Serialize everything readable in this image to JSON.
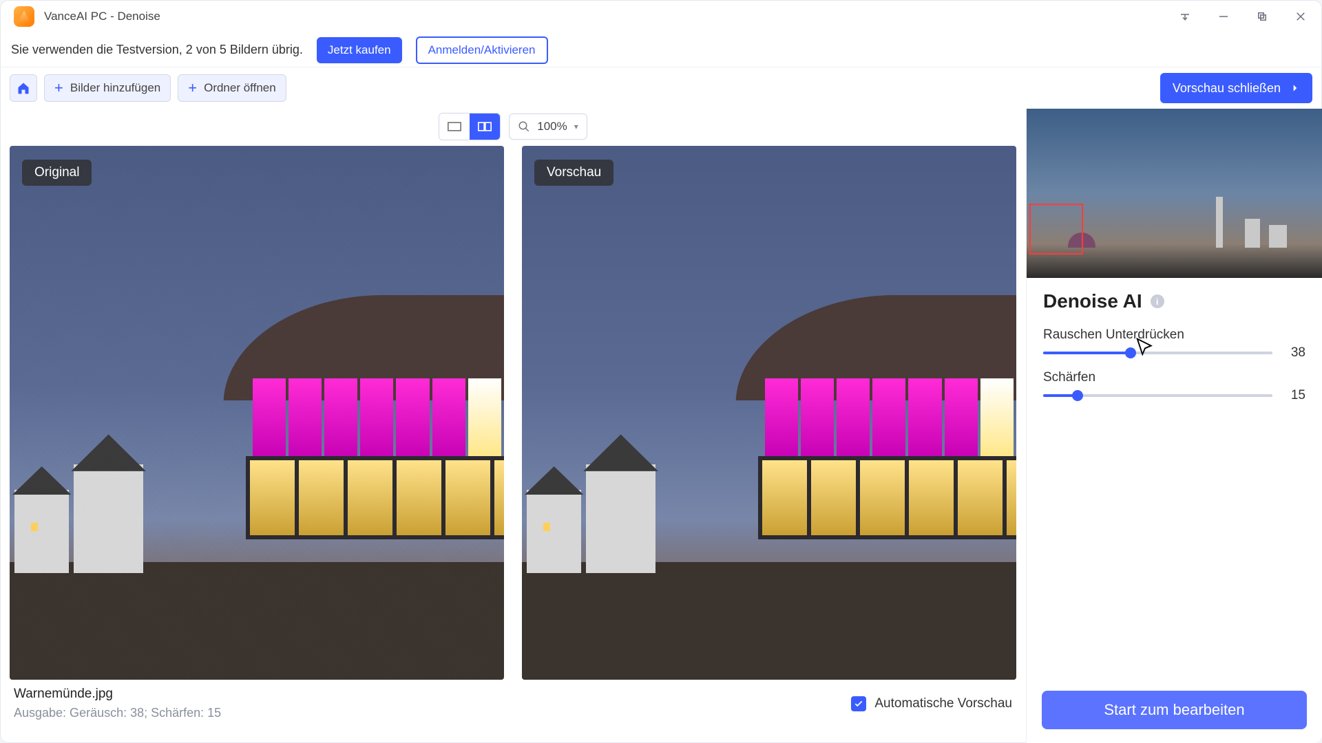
{
  "titlebar": {
    "title": "VanceAI PC - Denoise"
  },
  "trial": {
    "message": "Sie verwenden die Testversion, 2 von 5 Bildern übrig.",
    "buy": "Jetzt kaufen",
    "login": "Anmelden/Aktivieren"
  },
  "toolbar": {
    "add_images": "Bilder hinzufügen",
    "open_folder": "Ordner öffnen",
    "close_preview": "Vorschau schließen"
  },
  "view": {
    "zoom": "100%"
  },
  "compare": {
    "original_badge": "Original",
    "preview_badge": "Vorschau"
  },
  "footer": {
    "filename": "Warnemünde.jpg",
    "output": "Ausgabe: Geräusch: 38; Schärfen: 15",
    "auto_preview": "Automatische Vorschau"
  },
  "panel": {
    "title": "Denoise AI",
    "sliders": {
      "noise": {
        "label": "Rauschen Unterdrücken",
        "value": 38,
        "max": 100
      },
      "sharpen": {
        "label": "Schärfen",
        "value": 15,
        "max": 100
      }
    },
    "start": "Start zum bearbeiten"
  }
}
